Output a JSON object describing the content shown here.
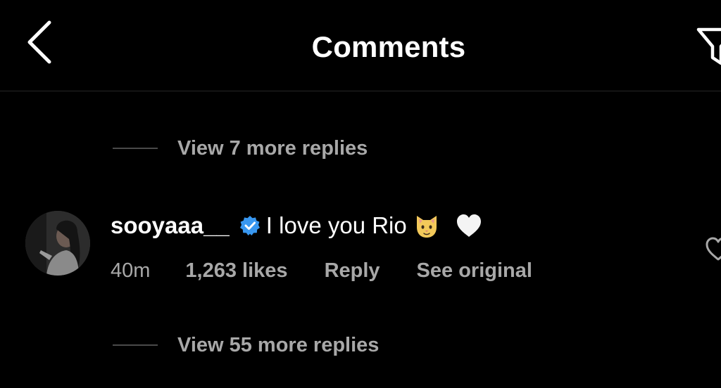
{
  "header": {
    "title": "Comments",
    "back_icon": "chevron-left-icon",
    "filter_icon": "filter-icon"
  },
  "replies_above": {
    "label": "View 7 more replies"
  },
  "comment": {
    "username": "sooyaaa__",
    "verified": true,
    "text": "I love you Rio",
    "emojis": [
      "cat-face-emoji",
      "white-heart-emoji"
    ],
    "time": "40m",
    "likes": "1,263 likes",
    "reply_label": "Reply",
    "see_original_label": "See original",
    "like_icon": "heart-outline-icon"
  },
  "replies_below": {
    "label": "View 55 more replies"
  },
  "colors": {
    "background": "#000000",
    "primary_text": "#ffffff",
    "secondary_text": "#a8a8a8",
    "verified_badge": "#3897f0",
    "divider": "#262626"
  }
}
